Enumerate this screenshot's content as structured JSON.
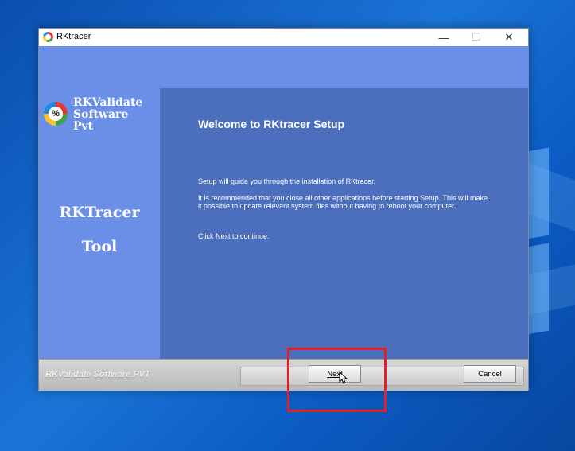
{
  "window": {
    "title": "RKtracer",
    "controls": {
      "minimize": "—",
      "maximize": "☐",
      "close": "✕"
    }
  },
  "sidebar": {
    "logo_percent": "%",
    "logo_line1": "RKValidate",
    "logo_line2": "Software",
    "logo_line3": "Pvt",
    "tool_line1": "RKTracer",
    "tool_line2": "Tool"
  },
  "content": {
    "heading": "Welcome to RKtracer Setup",
    "para1": "Setup will guide you through the installation of RKtracer.",
    "para2": "It is recommended that you close all other applications before starting Setup. This will make it possible to update relevant system files without having to reboot your computer.",
    "para3": "Click Next to continue."
  },
  "footer": {
    "brand": "RKValidate Software PVT",
    "next_label": "Next",
    "cancel_label": "Cancel"
  },
  "colors": {
    "sidebar_bg": "#6b8fe6",
    "content_bg": "#4b6fbd",
    "highlight": "#e0202a"
  }
}
